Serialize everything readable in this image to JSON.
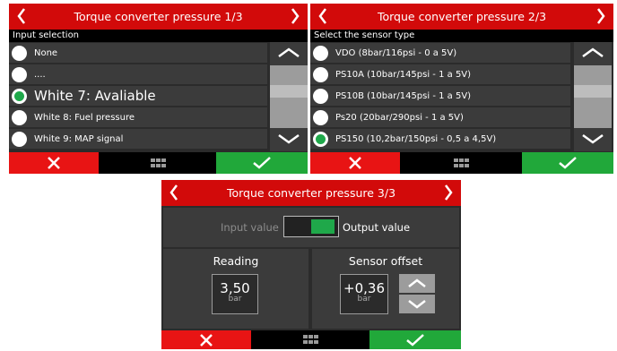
{
  "screen1": {
    "title": "Torque converter pressure 1/3",
    "header": "Input selection",
    "options": [
      {
        "label": "None",
        "selected": false
      },
      {
        "label": "....",
        "selected": false
      },
      {
        "label": "White 7: Avaliable",
        "selected": true
      },
      {
        "label": "White 8: Fuel pressure",
        "selected": false
      },
      {
        "label": "White 9: MAP signal",
        "selected": false
      }
    ]
  },
  "screen2": {
    "title": "Torque converter pressure 2/3",
    "header": "Select the sensor type",
    "options": [
      {
        "label": "VDO (8bar/116psi - 0 a 5V)",
        "selected": false
      },
      {
        "label": "PS10A (10bar/145psi - 1 a 5V)",
        "selected": false
      },
      {
        "label": "PS10B (10bar/145psi - 1 a 5V)",
        "selected": false
      },
      {
        "label": "Ps20 (20bar/290psi - 1 a 5V)",
        "selected": false
      },
      {
        "label": "PS150 (10,2bar/150psi - 0,5 a 4,5V)",
        "selected": true
      }
    ]
  },
  "screen3": {
    "title": "Torque converter pressure 3/3",
    "toggle_left": "Input value",
    "toggle_right": "Output value",
    "reading_label": "Reading",
    "reading_value": "3,50",
    "reading_unit": "bar",
    "offset_label": "Sensor offset",
    "offset_value": "+0,36",
    "offset_unit": "bar"
  },
  "icons": {
    "prev": "chevron-left-icon",
    "next": "chevron-right-icon",
    "cancel": "close-icon",
    "confirm": "checkmark-icon",
    "menu": "grid-menu-icon",
    "scroll_up": "chevron-up-icon",
    "scroll_down": "chevron-down-icon"
  },
  "colors": {
    "title_bar": "#d20a0a",
    "cancel": "#e81414",
    "confirm": "#21a83a",
    "selected_radio": "#1fa84a",
    "toggle_on": "#1fa84a"
  }
}
